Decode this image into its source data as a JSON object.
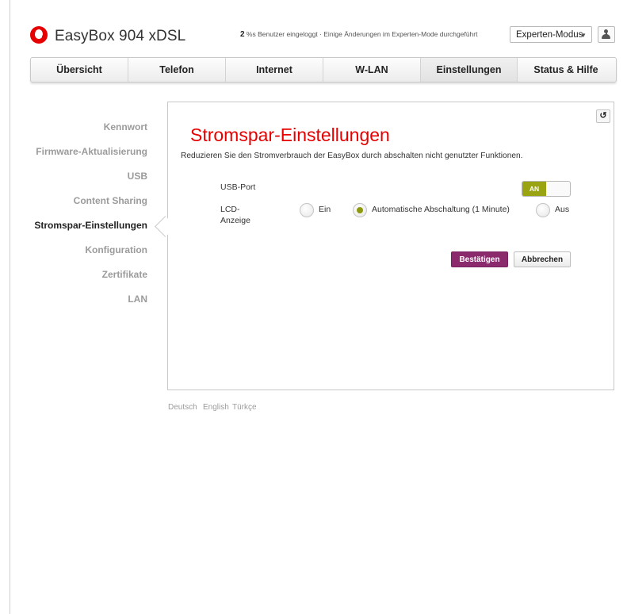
{
  "header": {
    "brand": "EasyBox 904 xDSL",
    "notice_count": "2",
    "notice_text": " %s Benutzer eingeloggt · Einige Änderungen im Experten-Mode durchgeführt",
    "mode_select": "Experten-Modus",
    "user_icon": "user-icon"
  },
  "nav": {
    "tabs": [
      {
        "label": "Übersicht"
      },
      {
        "label": "Telefon"
      },
      {
        "label": "Internet"
      },
      {
        "label": "W-LAN"
      },
      {
        "label": "Einstellungen",
        "active": true
      },
      {
        "label": "Status & Hilfe"
      }
    ]
  },
  "sidebar": {
    "items": [
      {
        "label": "Kennwort"
      },
      {
        "label": "Firmware-Aktualisierung"
      },
      {
        "label": "USB"
      },
      {
        "label": "Content Sharing"
      },
      {
        "label": "Stromspar-Einstellungen",
        "active": true
      },
      {
        "label": "Konfiguration"
      },
      {
        "label": "Zertifikate"
      },
      {
        "label": "LAN"
      }
    ]
  },
  "main": {
    "title": "Stromspar-Einstellungen",
    "description": "Reduzieren Sie den Stromverbrauch der EasyBox durch abschalten nicht genutzter Funktionen.",
    "usb_port_label": "USB-Port",
    "usb_toggle_label": "AN",
    "usb_toggle_state": "on",
    "lcd_label_line1": "LCD-",
    "lcd_label_line2": "Anzeige",
    "lcd_options": [
      {
        "label": "Ein",
        "selected": false
      },
      {
        "label": "Automatische Abschaltung (1 Minute)",
        "selected": true
      },
      {
        "label": "Aus",
        "selected": false
      }
    ],
    "confirm_button": "Bestätigen",
    "cancel_button": "Abbrechen",
    "reset_icon": "undo-icon"
  },
  "footer": {
    "languages": [
      "Deutsch",
      "English",
      "Türkçe"
    ]
  },
  "colors": {
    "brand_red": "#e60000",
    "accent_green": "#9aa312",
    "primary_button": "#8c2a6e"
  }
}
